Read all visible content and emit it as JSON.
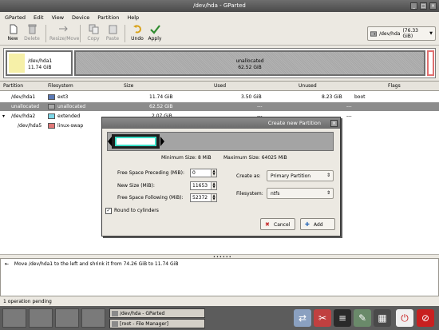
{
  "window": {
    "title": "/dev/hda - GParted"
  },
  "menubar": [
    "GParted",
    "Edit",
    "View",
    "Device",
    "Partition",
    "Help"
  ],
  "toolbar": {
    "new": "New",
    "delete": "Delete",
    "resize_move": "Resize/Move",
    "copy": "Copy",
    "paste": "Paste",
    "undo": "Undo",
    "apply": "Apply"
  },
  "device_selector": {
    "value": "/dev/hda",
    "size": "(76.33 GiB)"
  },
  "graph": {
    "hda1_name": "/dev/hda1",
    "hda1_size": "11.74 GiB",
    "unalloc_name": "unallocated",
    "unalloc_size": "62.52 GiB"
  },
  "table": {
    "headers": [
      "Partition",
      "Filesystem",
      "Size",
      "Used",
      "Unused",
      "Flags"
    ],
    "rows": [
      {
        "partition": "/dev/hda1",
        "filesystem": "ext3",
        "size": "11.74 GiB",
        "used": "3.50 GiB",
        "unused": "8.23 GiB",
        "flags": "boot",
        "color": "#5a78b4"
      },
      {
        "partition": "unallocated",
        "filesystem": "unallocated",
        "size": "62.52 GiB",
        "used": "---",
        "unused": "---",
        "flags": "",
        "color": "#a8a8a8"
      },
      {
        "partition": "/dev/hda2",
        "filesystem": "extended",
        "size": "2.07 GiB",
        "used": "---",
        "unused": "---",
        "flags": "",
        "color": "#7dd7e8"
      },
      {
        "partition": "/dev/hda5",
        "filesystem": "linux-swap",
        "size": "",
        "used": "",
        "unused": "",
        "flags": "",
        "color": "#e07878"
      }
    ]
  },
  "dialog": {
    "title": "Create new Partition",
    "min_size": "Minimum Size: 8 MiB",
    "max_size": "Maximum Size: 64025 MiB",
    "free_preceding_label": "Free Space Preceding (MiB):",
    "free_preceding_value": "0",
    "new_size_label": "New Size (MiB):",
    "new_size_value": "11653",
    "free_following_label": "Free Space Following (MiB):",
    "free_following_value": "52372",
    "create_as_label": "Create as:",
    "create_as_value": "Primary Partition",
    "filesystem_label": "Filesystem:",
    "filesystem_value": "ntfs",
    "round_label": "Round to cylinders",
    "round_checked": true,
    "cancel": "Cancel",
    "add": "Add"
  },
  "operations": [
    "Move /dev/hda1 to the left and shrink it from 74.26 GiB to 11.74 GiB"
  ],
  "status": "1 operation pending",
  "taskbar": {
    "task1": "/dev/hda - GParted",
    "task2": "[root - File Manager]"
  }
}
